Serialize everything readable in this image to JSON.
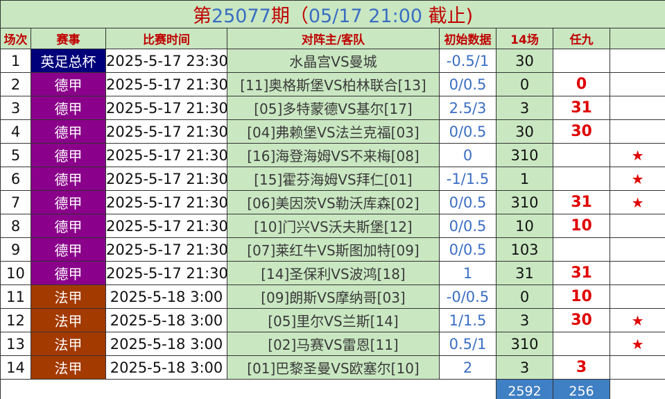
{
  "title": {
    "prefix": "第",
    "issue": "25077",
    "suffix": "期（",
    "date": "05/17 21:00",
    "end": " 截止)"
  },
  "headers": [
    "场次",
    "赛事",
    "比赛时间",
    "对阵主/客队",
    "初始数据",
    "14场",
    "任九",
    ""
  ],
  "colors": {
    "header_bg": "#c9e7c1",
    "header_text": "#c00000",
    "accent_blue": "#3a6ec2",
    "red": "#e00000"
  },
  "rows": [
    {
      "idx": "1",
      "league": "英足总杯",
      "league_color": "#00007a",
      "time": "2025-5-17 23:30",
      "match": "水晶宫VS曼城",
      "odds": "-0.5/1",
      "c14": "30",
      "r9": "",
      "star": ""
    },
    {
      "idx": "2",
      "league": "德甲",
      "league_color": "#8a008a",
      "time": "2025-5-17 21:30",
      "match": "[11]奥格斯堡VS柏林联合[13]",
      "odds": "0/0.5",
      "c14": "0",
      "r9": "0",
      "star": ""
    },
    {
      "idx": "3",
      "league": "德甲",
      "league_color": "#8a008a",
      "time": "2025-5-17 21:30",
      "match": "[05]多特蒙德VS基尔[17]",
      "odds": "2.5/3",
      "c14": "3",
      "r9": "31",
      "star": ""
    },
    {
      "idx": "4",
      "league": "德甲",
      "league_color": "#8a008a",
      "time": "2025-5-17 21:30",
      "match": "[04]弗赖堡VS法兰克福[03]",
      "odds": "0/0.5",
      "c14": "30",
      "r9": "30",
      "star": ""
    },
    {
      "idx": "5",
      "league": "德甲",
      "league_color": "#8a008a",
      "time": "2025-5-17 21:30",
      "match": "[16]海登海姆VS不来梅[08]",
      "odds": "0",
      "c14": "310",
      "r9": "",
      "star": "★"
    },
    {
      "idx": "6",
      "league": "德甲",
      "league_color": "#8a008a",
      "time": "2025-5-17 21:30",
      "match": "[15]霍芬海姆VS拜仁[01]",
      "odds": "-1/1.5",
      "c14": "1",
      "r9": "",
      "star": "★"
    },
    {
      "idx": "7",
      "league": "德甲",
      "league_color": "#8a008a",
      "time": "2025-5-17 21:30",
      "match": "[06]美因茨VS勒沃库森[02]",
      "odds": "0/0.5",
      "c14": "310",
      "r9": "31",
      "star": "★"
    },
    {
      "idx": "8",
      "league": "德甲",
      "league_color": "#8a008a",
      "time": "2025-5-17 21:30",
      "match": "[10]门兴VS沃夫斯堡[12]",
      "odds": "0/0.5",
      "c14": "10",
      "r9": "10",
      "star": ""
    },
    {
      "idx": "9",
      "league": "德甲",
      "league_color": "#8a008a",
      "time": "2025-5-17 21:30",
      "match": "[07]莱红牛VS斯图加特[09]",
      "odds": "0/0.5",
      "c14": "103",
      "r9": "",
      "star": ""
    },
    {
      "idx": "10",
      "league": "德甲",
      "league_color": "#8a008a",
      "time": "2025-5-17 21:30",
      "match": "[14]圣保利VS波鸿[18]",
      "odds": "1",
      "c14": "31",
      "r9": "31",
      "star": ""
    },
    {
      "idx": "11",
      "league": "法甲",
      "league_color": "#a33a00",
      "time": "2025-5-18 3:00",
      "match": "[09]朗斯VS摩纳哥[03]",
      "odds": "-0/0.5",
      "c14": "0",
      "r9": "10",
      "star": ""
    },
    {
      "idx": "12",
      "league": "法甲",
      "league_color": "#a33a00",
      "time": "2025-5-18 3:00",
      "match": "[05]里尔VS兰斯[14]",
      "odds": "1/1.5",
      "c14": "3",
      "r9": "30",
      "star": "★"
    },
    {
      "idx": "13",
      "league": "法甲",
      "league_color": "#a33a00",
      "time": "2025-5-18 3:00",
      "match": "[02]马赛VS雷恩[11]",
      "odds": "0.5/1",
      "c14": "310",
      "r9": "",
      "star": "★"
    },
    {
      "idx": "14",
      "league": "法甲",
      "league_color": "#a33a00",
      "time": "2025-5-18 3:00",
      "match": "[01]巴黎圣曼VS欧塞尔[10]",
      "odds": "2",
      "c14": "3",
      "r9": "3",
      "star": ""
    }
  ],
  "footer": {
    "total_14": "2592",
    "total_r9": "256"
  }
}
